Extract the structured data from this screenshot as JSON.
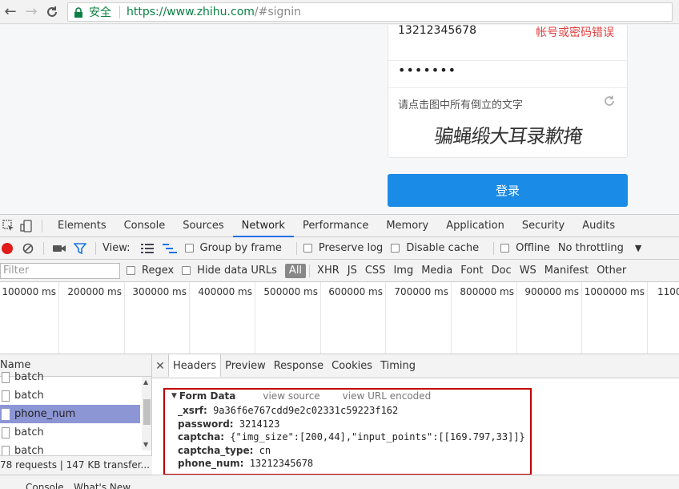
{
  "browser": {
    "secure_label": "安全",
    "url_host": "https://www.zhihu.com",
    "url_path": "/#signin"
  },
  "login": {
    "phone": "13212345678",
    "error": "帐号或密码错误",
    "password_mask": "•••••••",
    "captcha_hint": "请点击图中所有倒立的文字",
    "captcha_text": "骗蝇缎大耳录歉掩",
    "submit": "登录"
  },
  "devtools": {
    "tabs": [
      "Elements",
      "Console",
      "Sources",
      "Network",
      "Performance",
      "Memory",
      "Application",
      "Security",
      "Audits"
    ],
    "active_tab": "Network",
    "toolbar": {
      "view_label": "View:",
      "group_by_frame": "Group by frame",
      "preserve_log": "Preserve log",
      "disable_cache": "Disable cache",
      "offline": "Offline",
      "throttling": "No throttling"
    },
    "filter": {
      "placeholder": "Filter",
      "regex": "Regex",
      "hide_data_urls": "Hide data URLs",
      "types": [
        "All",
        "XHR",
        "JS",
        "CSS",
        "Img",
        "Media",
        "Font",
        "Doc",
        "WS",
        "Manifest",
        "Other"
      ],
      "active_type": "All"
    },
    "timeline_ticks": [
      "100000 ms",
      "200000 ms",
      "300000 ms",
      "400000 ms",
      "500000 ms",
      "600000 ms",
      "700000 ms",
      "800000 ms",
      "900000 ms",
      "1000000 ms",
      "1100"
    ],
    "requests": {
      "header": "Name",
      "rows": [
        "batch",
        "batch",
        "phone_num",
        "batch",
        "batch"
      ],
      "selected_index": 2,
      "status": "78 requests  |  147 KB transfer..."
    },
    "detail": {
      "tabs": [
        "Headers",
        "Preview",
        "Response",
        "Cookies",
        "Timing"
      ],
      "active_tab": "Headers",
      "form_title": "Form Data",
      "view_source": "view source",
      "view_url_encoded": "view URL encoded",
      "fields": [
        {
          "key": "_xsrf:",
          "value": "9a36f6e767cdd9e2c02331c59223f162"
        },
        {
          "key": "password:",
          "value": "3214123"
        },
        {
          "key": "captcha:",
          "value": "{\"img_size\":[200,44],\"input_points\":[[169.797,33]]}"
        },
        {
          "key": "captcha_type:",
          "value": "cn"
        },
        {
          "key": "phone_num:",
          "value": "13212345678"
        }
      ]
    },
    "drawer_tabs": [
      "Console",
      "What's New"
    ]
  },
  "colors": {
    "accent": "#1a8be6",
    "error": "#e04040",
    "secure": "#0b8043",
    "selected_row": "#8d96d4",
    "highlight_box": "#c00000"
  }
}
